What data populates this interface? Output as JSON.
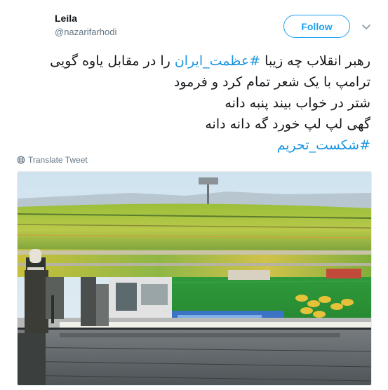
{
  "user": {
    "display_name": "Leila",
    "handle": "@nazarifarhodi"
  },
  "follow_label": "Follow",
  "tweet": {
    "line1_before": "رهبر انقلاب چه زیبا ",
    "hashtag1": "#عظمت_ایران",
    "line1_after": " را در مقابل یاوه گویی",
    "line2": "ترامپ با یک شعر تمام کرد و فرمود",
    "line3": "شتر در خواب بیند پنبه دانه",
    "line4": "گهی لپ لپ خورد گه دانه دانه",
    "hashtag2": "#شکست_تحریم"
  },
  "translate_label": "Translate Tweet",
  "colors": {
    "accent": "#1da1f2",
    "hashtag": "#1b95e0",
    "secondary_text": "#657786"
  },
  "icons": {
    "chevron": "chevron-down-icon",
    "globe": "globe-icon"
  }
}
